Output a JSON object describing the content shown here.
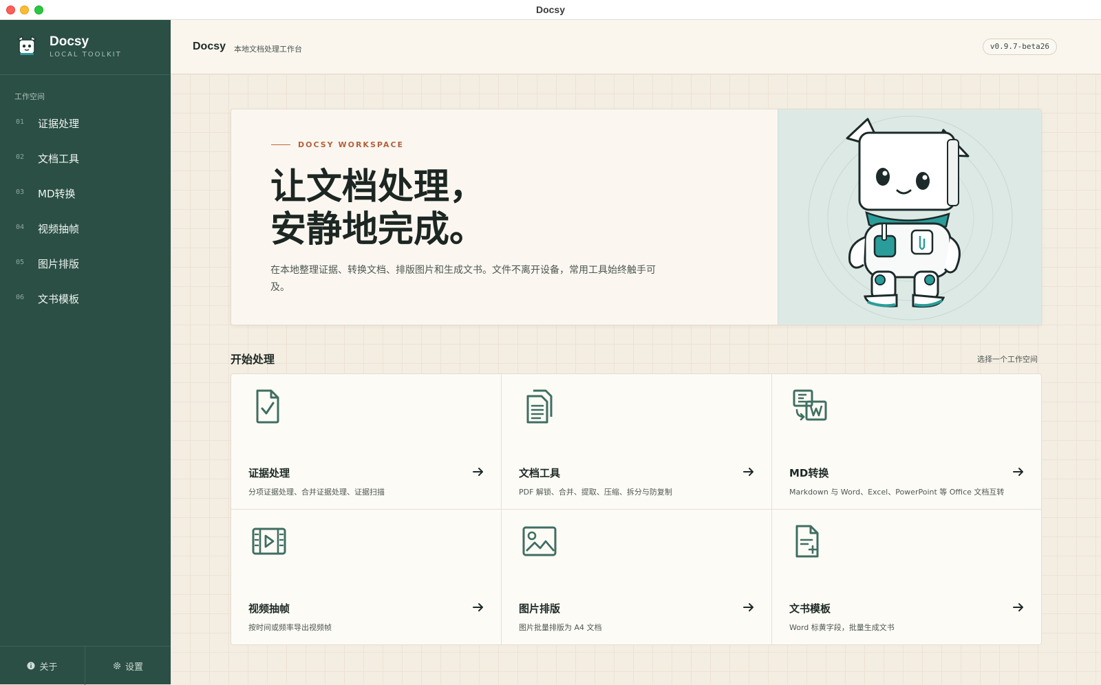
{
  "window": {
    "title": "Docsy"
  },
  "brand": {
    "name": "Docsy",
    "subtitle": "LOCAL TOOLKIT"
  },
  "sidebar": {
    "section_label": "工作空间",
    "items": [
      {
        "num": "01",
        "label": "证据处理"
      },
      {
        "num": "02",
        "label": "文档工具"
      },
      {
        "num": "03",
        "label": "MD转换"
      },
      {
        "num": "04",
        "label": "视频抽帧"
      },
      {
        "num": "05",
        "label": "图片排版"
      },
      {
        "num": "06",
        "label": "文书模板"
      }
    ],
    "footer": {
      "about": "关于",
      "settings": "设置"
    }
  },
  "header": {
    "title": "Docsy",
    "subtitle": "本地文档处理工作台",
    "version": "v0.9.7-beta26"
  },
  "hero": {
    "tag": "DOCSY WORKSPACE",
    "title_line1": "让文档处理，",
    "title_line2": "安静地完成。",
    "description": "在本地整理证据、转换文档、排版图片和生成文书。文件不离开设备，常用工具始终触手可及。"
  },
  "start": {
    "title": "开始处理",
    "hint": "选择一个工作空间",
    "cards": [
      {
        "title": "证据处理",
        "desc": "分项证据处理、合并证据处理、证据扫描",
        "icon": "document-check-icon"
      },
      {
        "title": "文档工具",
        "desc": "PDF 解锁、合并、提取、压缩、拆分与防复制",
        "icon": "documents-stack-icon"
      },
      {
        "title": "MD转换",
        "desc": "Markdown 与 Word、Excel、PowerPoint 等 Office 文档互转",
        "icon": "convert-md-word-icon"
      },
      {
        "title": "视频抽帧",
        "desc": "按时间或频率导出视频帧",
        "icon": "video-film-icon"
      },
      {
        "title": "图片排版",
        "desc": "图片批量排版为 A4 文档",
        "icon": "image-icon"
      },
      {
        "title": "文书模板",
        "desc": "Word 标黄字段，批量生成文书",
        "icon": "document-add-icon"
      }
    ]
  },
  "colors": {
    "sidebar": "#2b4f45",
    "accent": "#b5603c",
    "icon": "#3f6e62",
    "background": "#f4ede2"
  }
}
